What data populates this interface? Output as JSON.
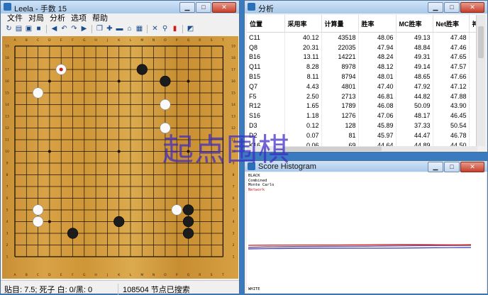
{
  "leela": {
    "title": "Leela - 手数 15",
    "menu": [
      "文件",
      "对局",
      "分析",
      "选项",
      "帮助"
    ],
    "toolbar_icons": [
      "new-game-icon",
      "open-icon",
      "open-folder-icon",
      "save-icon",
      "back-icon",
      "undo-icon",
      "redo-icon",
      "forward-icon",
      "copy-icon",
      "add-icon",
      "remove-icon",
      "home-icon",
      "print-icon",
      "cancel-icon",
      "find-icon",
      "stop-icon",
      "analyze-icon"
    ],
    "board": {
      "size": 19,
      "col_labels": [
        "A",
        "B",
        "C",
        "D",
        "E",
        "F",
        "G",
        "H",
        "J",
        "K",
        "L",
        "M",
        "N",
        "O",
        "P",
        "Q",
        "R",
        "S",
        "T"
      ],
      "black_stones": [
        "M17",
        "O16",
        "Q4",
        "Q5",
        "Q3",
        "F3",
        "K4"
      ],
      "white_stones": [
        "C15",
        "O14",
        "C5",
        "C4",
        "P5",
        "O12"
      ],
      "last_move": "E17"
    },
    "status": {
      "left": "贴目: 7.5; 死子 白: 0/黑: 0",
      "right": "108504 节点已搜索"
    }
  },
  "analysis": {
    "title": "分析",
    "columns": [
      "位置",
      "采用率",
      "计算量",
      "胜率",
      "MC胜率",
      "Net胜率",
      "神经"
    ],
    "rows": [
      [
        "C11",
        "40.12",
        "43518",
        "48.06",
        "49.13",
        "47.48"
      ],
      [
        "Q8",
        "20.31",
        "22035",
        "47.94",
        "48.84",
        "47.46"
      ],
      [
        "B16",
        "13.11",
        "14221",
        "48.24",
        "49.31",
        "47.65"
      ],
      [
        "Q11",
        "8.28",
        "8978",
        "48.12",
        "49.14",
        "47.57"
      ],
      [
        "B15",
        "8.11",
        "8794",
        "48.01",
        "48.65",
        "47.66"
      ],
      [
        "Q7",
        "4.43",
        "4801",
        "47.40",
        "47.92",
        "47.12"
      ],
      [
        "F5",
        "2.50",
        "2713",
        "46.81",
        "44.82",
        "47.88"
      ],
      [
        "R12",
        "1.65",
        "1789",
        "46.08",
        "50.09",
        "43.90"
      ],
      [
        "S16",
        "1.18",
        "1276",
        "47.06",
        "48.17",
        "46.45"
      ],
      [
        "D3",
        "0.12",
        "128",
        "45.89",
        "37.33",
        "50.54"
      ],
      [
        "D2",
        "0.07",
        "81",
        "45.97",
        "44.47",
        "46.78"
      ],
      [
        "K16",
        "0.06",
        "69",
        "44.64",
        "44.89",
        "44.50"
      ]
    ]
  },
  "histogram": {
    "title": "Score Histogram",
    "legend": [
      "BLACK",
      "Combined",
      "Monte Carlo",
      "Network"
    ],
    "footer": "WHITE",
    "colors": {
      "combined": "#7a5a9a",
      "monte_carlo": "#3a3aa8",
      "network": "#c81e1e"
    }
  },
  "watermark": "起点围棋"
}
